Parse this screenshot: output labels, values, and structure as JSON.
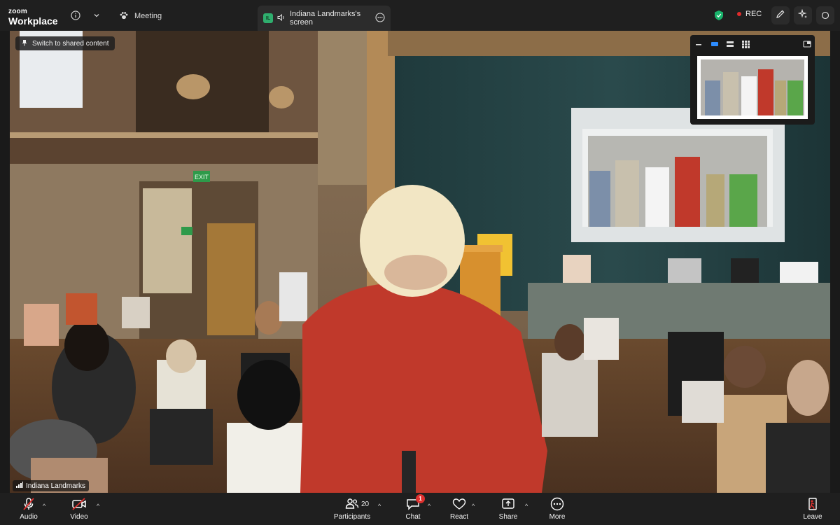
{
  "app": {
    "brand_line1": "zoom",
    "brand_line2": "Workplace"
  },
  "topbar": {
    "meeting_label": "Meeting",
    "share_tab": {
      "avatar_initials": "IL",
      "label": "Indiana Landmarks's screen"
    },
    "rec_label": "REC"
  },
  "stage": {
    "switch_label": "Switch to shared content",
    "participant_name": "Indiana Landmarks",
    "exit_sign": "EXIT"
  },
  "toolbar": {
    "audio_label": "Audio",
    "video_label": "Video",
    "participants_label": "Participants",
    "participants_count": "20",
    "chat_label": "Chat",
    "chat_badge": "1",
    "react_label": "React",
    "share_label": "Share",
    "more_label": "More",
    "leave_label": "Leave"
  },
  "colors": {
    "accent_green": "#19b36b",
    "rec_red": "#e02b2b",
    "leave_red": "#e0302e",
    "toolbar_bg": "#1f1f1f"
  },
  "icons": [
    "info-icon",
    "chevron-down-icon",
    "paw-icon",
    "speaker-icon",
    "ellipsis-icon",
    "shield-icon",
    "pencil-icon",
    "sparkle-icon",
    "pin-icon",
    "signal-icon",
    "mic-muted-icon",
    "video-off-icon",
    "participants-icon",
    "chat-icon",
    "react-icon",
    "share-icon",
    "more-icon",
    "leave-icon"
  ]
}
